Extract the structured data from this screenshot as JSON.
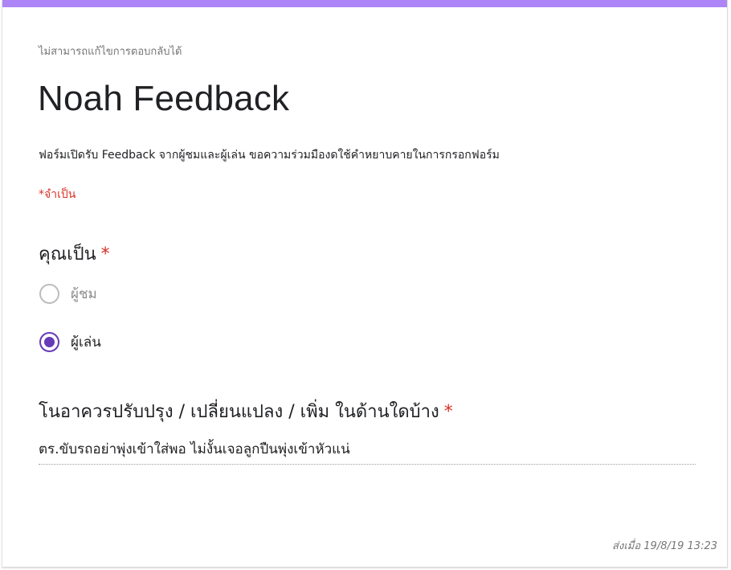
{
  "colors": {
    "accent": "#ad85f6",
    "radio_selected": "#673ab7",
    "required": "#d93025"
  },
  "form": {
    "edit_note": "ไม่สามารถแก้ไขการตอบกลับได้",
    "title": "Noah Feedback",
    "description": "ฟอร์มเปิดรับ Feedback จากผู้ชมและผู้เล่น ขอความร่วมมืองดใช้คำหยาบคายในการกรอกฟอร์ม",
    "required_note": "*จำเป็น"
  },
  "questions": [
    {
      "title": "คุณเป็น",
      "required_mark": "*",
      "type": "radio",
      "options": [
        {
          "label": "ผู้ชม",
          "selected": false
        },
        {
          "label": "ผู้เล่น",
          "selected": true
        }
      ]
    },
    {
      "title": "โนอาควรปรับปรุง / เปลี่ยนแปลง / เพิ่ม ในด้านใดบ้าง",
      "required_mark": "*",
      "type": "text",
      "answer": "ตร.ขับรถอย่าพุ่งเข้าใส่พอ ไม่งั้นเจอลูกปืนพุ่งเข้าหัวแน่"
    }
  ],
  "footer": {
    "submitted": "ส่งเมื่อ 19/8/19 13:23"
  }
}
